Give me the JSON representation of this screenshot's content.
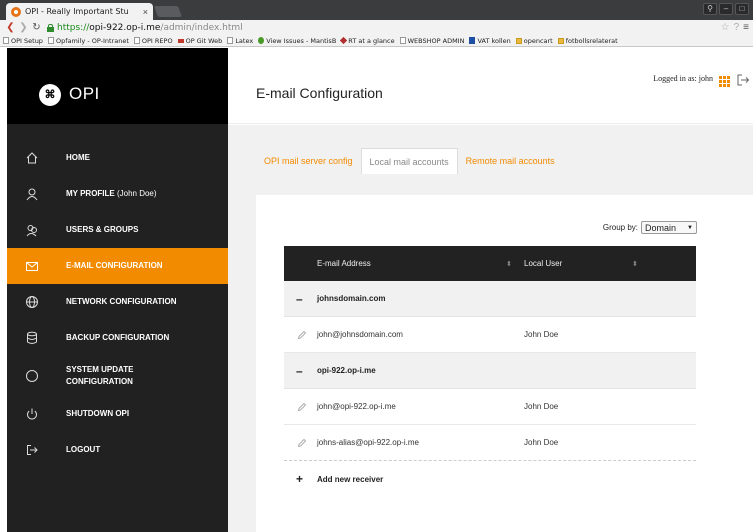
{
  "browser": {
    "tab_title": "OPI - Really Important Stu",
    "tab_close": "×",
    "url_proto": "https://",
    "url_host": "opi-922.op-i.me",
    "url_path": "/admin/index.html",
    "bookmarks": [
      "OPI Setup",
      "Opfamily - OP-Intranet",
      "OPI REPO",
      "OP Git Web",
      "Latex",
      "View Issues - MantisB",
      "RT at a glance",
      "WEBSHOP ADMIN",
      "VAT kollen",
      "opencart",
      "fotbollsrelaterat"
    ]
  },
  "sidebar": {
    "logo_text": "OPI",
    "items": [
      {
        "label": "HOME",
        "sub": "",
        "icon": "home-icon"
      },
      {
        "label": "MY PROFILE",
        "sub": " (John Doe)",
        "icon": "user-icon"
      },
      {
        "label": "USERS & GROUPS",
        "sub": "",
        "icon": "users-icon"
      },
      {
        "label": "E-MAIL CONFIGURATION",
        "sub": "",
        "icon": "mail-icon"
      },
      {
        "label": "NETWORK CONFIGURATION",
        "sub": "",
        "icon": "globe-icon"
      },
      {
        "label": "BACKUP CONFIGURATION",
        "sub": "",
        "icon": "database-icon"
      },
      {
        "label": "SYSTEM UPDATE",
        "label2": "CONFIGURATION",
        "sub": "",
        "icon": "update-icon"
      },
      {
        "label": "SHUTDOWN OPI",
        "sub": "",
        "icon": "power-icon"
      },
      {
        "label": "LOGOUT",
        "sub": "",
        "icon": "logout-icon"
      }
    ],
    "active_index": 3,
    "accent": "#f28b00"
  },
  "header": {
    "title": "E-mail Configuration",
    "logged_in": "Logged in as: john"
  },
  "main": {
    "tabs": [
      "OPI mail server config",
      "Local mail accounts",
      "Remote mail accounts"
    ],
    "active_tab": 1,
    "groupby_label": "Group by:",
    "groupby_value": "Domain",
    "table": {
      "col_email": "E-mail Address",
      "col_user": "Local User",
      "sort_glyph": "⬍",
      "groups": [
        {
          "domain": "johnsdomain.com",
          "rows": [
            {
              "email": "john@johnsdomain.com",
              "user": "John Doe"
            }
          ]
        },
        {
          "domain": "opi-922.op-i.me",
          "rows": [
            {
              "email": "john@opi-922.op-i.me",
              "user": "John Doe"
            },
            {
              "email": "johns-alias@opi-922.op-i.me",
              "user": "John Doe"
            }
          ]
        }
      ],
      "add_label": "Add new receiver"
    }
  }
}
